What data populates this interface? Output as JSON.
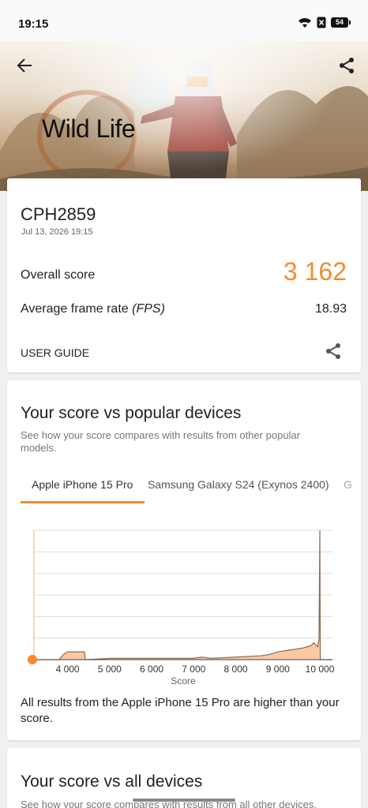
{
  "status": {
    "time": "19:15",
    "battery": "54"
  },
  "hero": {
    "title": "Wild Life"
  },
  "result": {
    "device": "CPH2859",
    "date": "Jul 13, 2026 19:15",
    "overall_label": "Overall score",
    "overall_score": "3 162",
    "fps_label": "Average frame rate",
    "fps_unit": "(FPS)",
    "fps_value": "18.93",
    "guide_label": "USER GUIDE"
  },
  "popular": {
    "title": "Your score vs popular devices",
    "subtitle": "See how your score compares with results from other popular models.",
    "tabs": [
      "Apple iPhone 15 Pro",
      "Samsung Galaxy S24 (Exynos 2400)",
      "G"
    ],
    "verdict": "All results from the Apple iPhone 15 Pro are higher than your score."
  },
  "all_devices": {
    "title": "Your score vs all devices",
    "subtitle": "See how your score compares with results from all other devices."
  },
  "colors": {
    "accent": "#f58a2e",
    "fill": "#f9c9a4",
    "line": "#8a6b55"
  },
  "chart_data": {
    "type": "area",
    "xlabel": "Score",
    "x_ticks": [
      "4 000",
      "5 000",
      "6 000",
      "7 000",
      "8 000",
      "9 000",
      "10 000"
    ],
    "xlim": [
      3200,
      10300
    ],
    "your_score": 3162,
    "grid": true,
    "x": [
      3200,
      3800,
      3900,
      4000,
      4400,
      4420,
      5000,
      6000,
      7000,
      7200,
      7400,
      8000,
      8600,
      8800,
      9000,
      9200,
      9400,
      9600,
      9800,
      9850,
      9950,
      9980,
      10000,
      10010,
      10300
    ],
    "values": [
      0,
      0,
      4,
      6,
      6,
      0,
      1,
      1,
      1,
      2,
      1,
      2,
      3,
      4,
      6,
      7,
      8,
      9,
      11,
      13,
      10,
      16,
      100,
      0,
      0
    ]
  }
}
